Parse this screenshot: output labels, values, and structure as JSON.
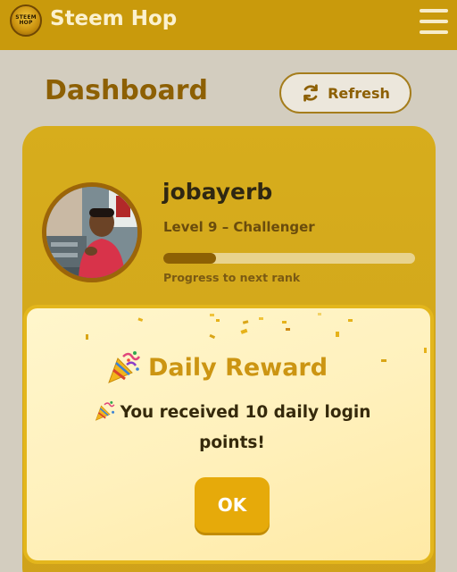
{
  "header": {
    "app_title": "Steem Hop",
    "logo_text_line1": "STEEM",
    "logo_text_line2": "HOP",
    "menu_icon": "hamburger-menu-icon",
    "colors": {
      "bar": "#c99a0c",
      "title": "#fbf1cf"
    }
  },
  "page": {
    "title": "Dashboard",
    "refresh_label": "Refresh",
    "refresh_icon": "refresh-icon"
  },
  "profile": {
    "username": "jobayerb",
    "level_text": "Level 9 – Challenger",
    "progress_fraction": 0.21,
    "progress_label": "Progress to next rank"
  },
  "modal": {
    "title": "Daily Reward",
    "title_icon": "party-popper-icon",
    "message": "You received 10 daily login points!",
    "ok_label": "OK",
    "colors": {
      "accent": "#cc9512",
      "button": "#e6aa0a",
      "border": "#e3b61c"
    }
  }
}
